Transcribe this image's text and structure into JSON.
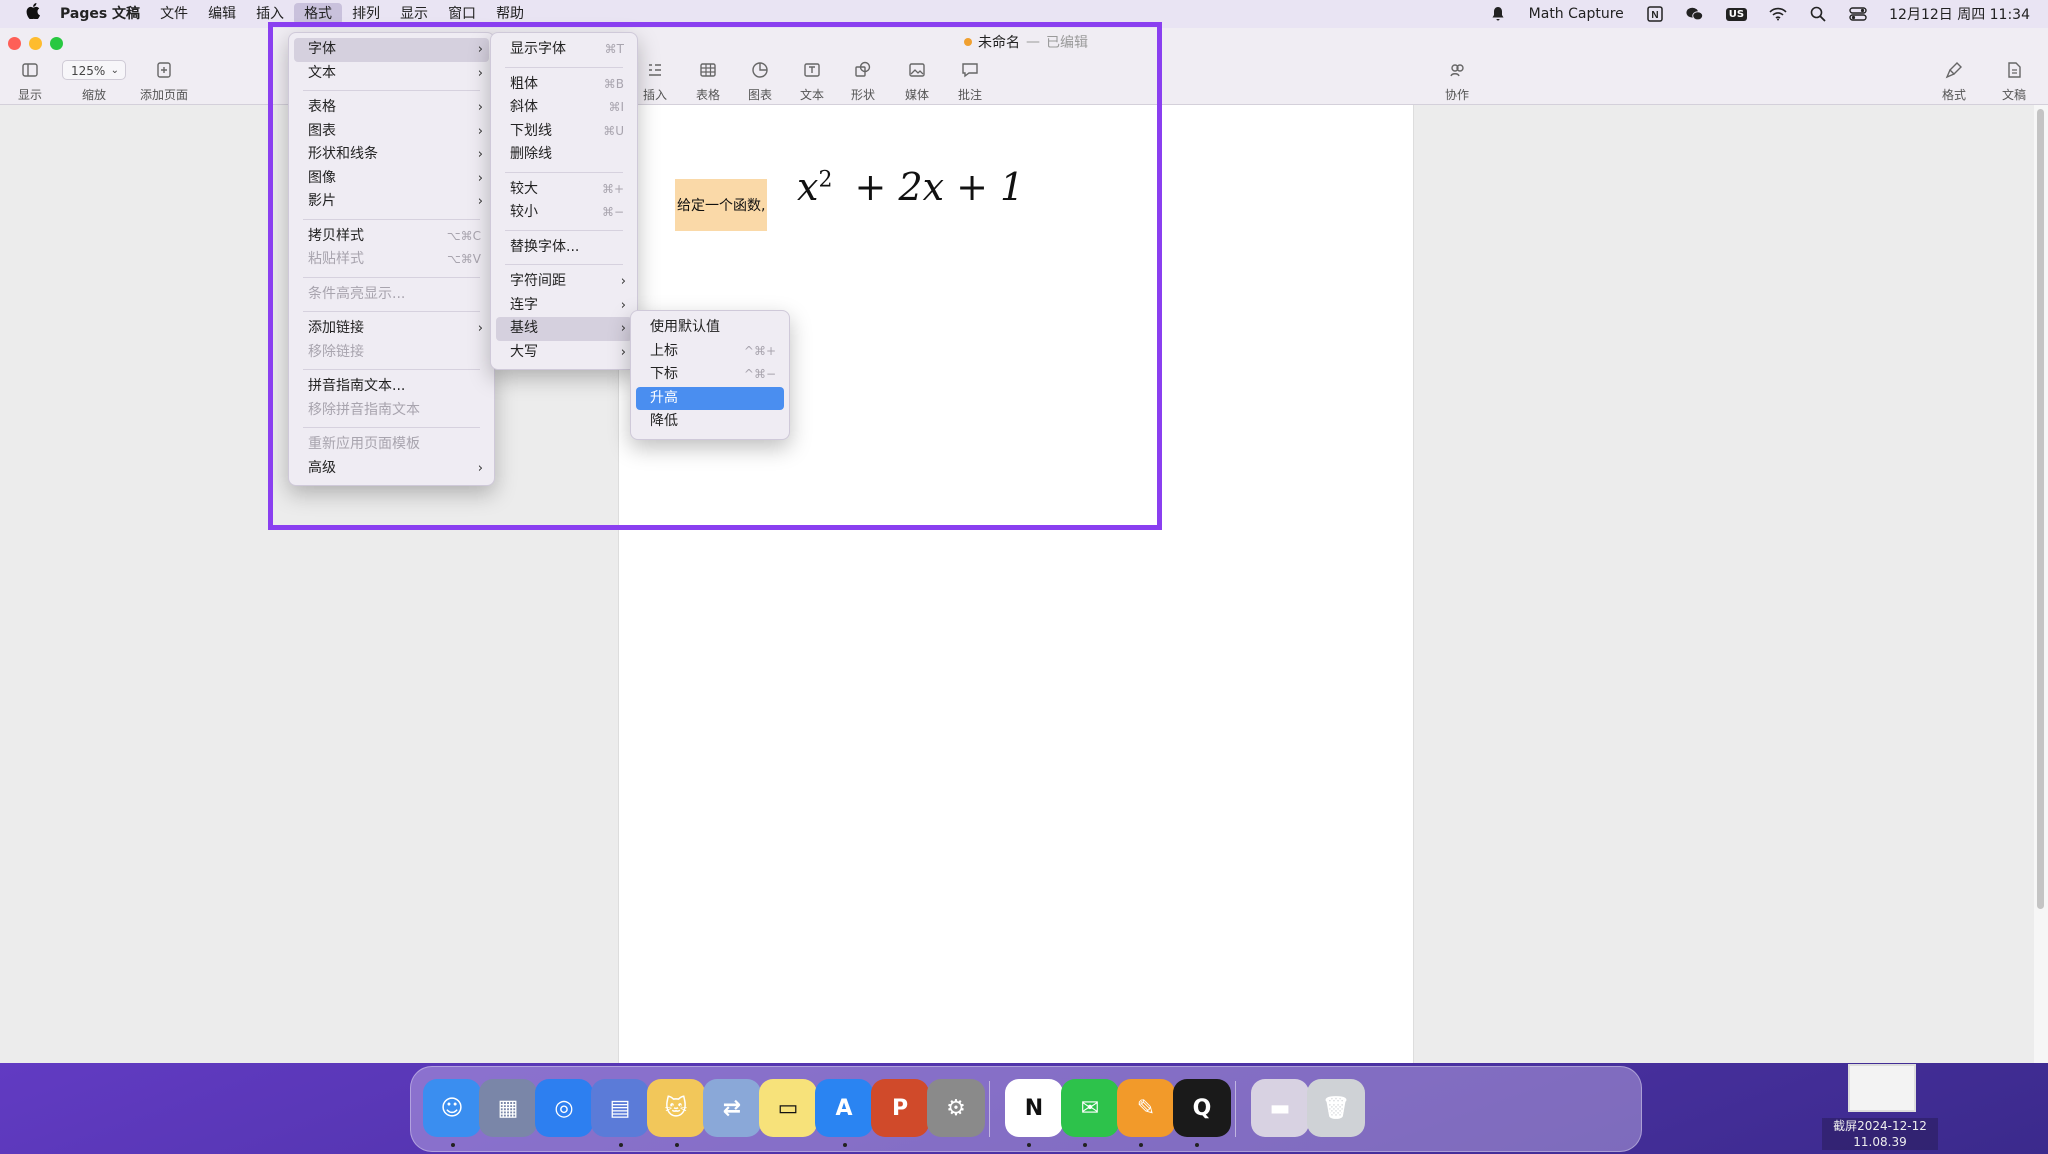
{
  "menubar": {
    "app_name": "Pages 文稿",
    "menus": [
      "文件",
      "编辑",
      "插入",
      "格式",
      "排列",
      "显示",
      "窗口",
      "帮助"
    ],
    "active_menu": "格式",
    "right_items": {
      "math_capture": "Math Capture",
      "input_source": "US",
      "datetime": "12月12日 周四 11:34"
    }
  },
  "window": {
    "doc_title": "未命名",
    "separator": "—",
    "doc_status": "已编辑",
    "zoom_value": "125%",
    "toolbar_left": {
      "view": "显示",
      "zoom": "缩放",
      "add_page": "添加页面"
    },
    "toolbar_center": [
      "插入",
      "表格",
      "图表",
      "文本",
      "形状",
      "媒体",
      "批注"
    ],
    "toolbar_collab": "协作",
    "toolbar_right": [
      "格式",
      "文稿"
    ]
  },
  "document": {
    "highlighted_text": "给定一个函数,",
    "formula": {
      "x": "x",
      "exp": "2",
      "rest": "+ 2x + 1"
    }
  },
  "format_menu": {
    "items": [
      {
        "label": "字体",
        "submenu": true,
        "highlighted": true
      },
      {
        "label": "文本",
        "submenu": true
      },
      {
        "sep": true
      },
      {
        "label": "表格",
        "submenu": true
      },
      {
        "label": "图表",
        "submenu": true
      },
      {
        "label": "形状和线条",
        "submenu": true
      },
      {
        "label": "图像",
        "submenu": true
      },
      {
        "label": "影片",
        "submenu": true
      },
      {
        "sep": true
      },
      {
        "label": "拷贝样式",
        "shortcut": "⌥⌘C"
      },
      {
        "label": "粘贴样式",
        "shortcut": "⌥⌘V",
        "disabled": true
      },
      {
        "sep": true
      },
      {
        "label": "条件高亮显示...",
        "disabled": true
      },
      {
        "sep": true
      },
      {
        "label": "添加链接",
        "submenu": true
      },
      {
        "label": "移除链接",
        "disabled": true
      },
      {
        "sep": true
      },
      {
        "label": "拼音指南文本..."
      },
      {
        "label": "移除拼音指南文本",
        "disabled": true
      },
      {
        "sep": true
      },
      {
        "label": "重新应用页面模板",
        "disabled": true
      },
      {
        "label": "高级",
        "submenu": true
      }
    ]
  },
  "font_menu": {
    "items": [
      {
        "label": "显示字体",
        "shortcut": "⌘T"
      },
      {
        "sep": true
      },
      {
        "label": "粗体",
        "shortcut": "⌘B"
      },
      {
        "label": "斜体",
        "shortcut": "⌘I"
      },
      {
        "label": "下划线",
        "shortcut": "⌘U"
      },
      {
        "label": "删除线"
      },
      {
        "sep": true
      },
      {
        "label": "较大",
        "shortcut": "⌘+"
      },
      {
        "label": "较小",
        "shortcut": "⌘−"
      },
      {
        "sep": true
      },
      {
        "label": "替换字体..."
      },
      {
        "sep": true
      },
      {
        "label": "字符间距",
        "submenu": true
      },
      {
        "label": "连字",
        "submenu": true
      },
      {
        "label": "基线",
        "submenu": true,
        "highlighted": true
      },
      {
        "label": "大写",
        "submenu": true
      }
    ]
  },
  "baseline_menu": {
    "items": [
      {
        "label": "使用默认值"
      },
      {
        "label": "上标",
        "shortcut": "^⌘+"
      },
      {
        "label": "下标",
        "shortcut": "^⌘−"
      },
      {
        "label": "升高",
        "selected": true
      },
      {
        "label": "降低"
      }
    ]
  },
  "dock": {
    "apps": [
      {
        "name": "finder-app",
        "color": "#3a8ef0",
        "glyph": "☺"
      },
      {
        "name": "launchpad-app",
        "color": "#7a86a8",
        "glyph": "▦"
      },
      {
        "name": "safari-app",
        "color": "#2d7ff0",
        "glyph": "◎"
      },
      {
        "name": "scanner-app",
        "color": "#5b7bd8",
        "glyph": "▤"
      },
      {
        "name": "cat-app",
        "color": "#f2c75a",
        "glyph": "🐱"
      },
      {
        "name": "transfer-app",
        "color": "#8aa8d8",
        "glyph": "⇄"
      },
      {
        "name": "notes-app",
        "color": "#f7e27a",
        "glyph": "▭"
      },
      {
        "name": "app-store-app",
        "color": "#2a84f2",
        "glyph": "A"
      },
      {
        "name": "powerpoint-app",
        "color": "#d04a2a",
        "glyph": "P"
      },
      {
        "name": "system-settings-app",
        "color": "#8a8a8a",
        "glyph": "⚙"
      },
      {
        "name": "notion-app",
        "color": "#ffffff",
        "glyph": "N"
      },
      {
        "name": "wechat-app",
        "color": "#2dc24b",
        "glyph": "✉"
      },
      {
        "name": "pages-app",
        "color": "#f29a2a",
        "glyph": "✎"
      },
      {
        "name": "qq-app",
        "color": "#1a1a1a",
        "glyph": "Q"
      },
      {
        "name": "downloads-stack",
        "color": "#d8d2e2",
        "glyph": "▬"
      },
      {
        "name": "trash-app",
        "color": "#cfd2d6",
        "glyph": "🗑"
      }
    ]
  },
  "screenshot_thumb": {
    "line1": "截屏2024-12-12",
    "line2": "11.08.39"
  }
}
